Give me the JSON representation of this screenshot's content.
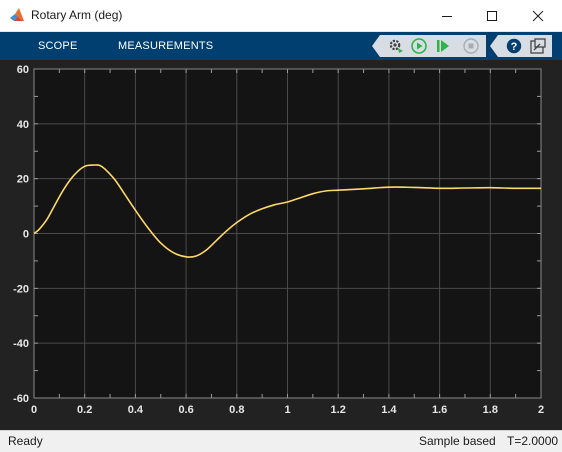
{
  "window": {
    "title": "Rotary Arm (deg)",
    "icon": "matlab-logo-icon",
    "minimize_icon": "minimize-icon",
    "maximize_icon": "maximize-icon",
    "close_icon": "close-icon"
  },
  "toolstrip": {
    "tabs": [
      {
        "label": "SCOPE"
      },
      {
        "label": "MEASUREMENTS"
      }
    ],
    "buttons": [
      {
        "icon": "settings-gear-icon"
      },
      {
        "icon": "run-icon"
      },
      {
        "icon": "step-forward-icon"
      },
      {
        "icon": "stop-icon"
      },
      {
        "icon": "help-icon"
      },
      {
        "icon": "undock-icon"
      }
    ],
    "colors": {
      "background": "#003f6f",
      "run_green": "#2db34a"
    }
  },
  "chart_data": {
    "type": "line",
    "title": "",
    "xlabel": "",
    "ylabel": "",
    "xlim": [
      0,
      2
    ],
    "ylim": [
      -60,
      60
    ],
    "x_ticks": [
      "0",
      "0.2",
      "0.4",
      "0.6",
      "0.8",
      "1",
      "1.2",
      "1.4",
      "1.6",
      "1.8",
      "2"
    ],
    "y_ticks": [
      "60",
      "40",
      "20",
      "0",
      "-20",
      "-40",
      "-60"
    ],
    "grid": true,
    "background": "#141414",
    "series": [
      {
        "color": "#ffd966",
        "x": [
          0,
          0.02,
          0.05,
          0.08,
          0.12,
          0.16,
          0.2,
          0.24,
          0.26,
          0.28,
          0.32,
          0.36,
          0.4,
          0.45,
          0.5,
          0.55,
          0.6,
          0.64,
          0.68,
          0.72,
          0.76,
          0.8,
          0.85,
          0.9,
          0.95,
          1.0,
          1.05,
          1.1,
          1.15,
          1.2,
          1.3,
          1.4,
          1.5,
          1.6,
          1.7,
          1.8,
          1.9,
          2.0
        ],
        "y": [
          0,
          1.5,
          5,
          10,
          16.5,
          21.5,
          24.5,
          25,
          24.8,
          23.5,
          19.5,
          14,
          8.5,
          2,
          -3.5,
          -7,
          -8.5,
          -8.2,
          -6,
          -2.5,
          1,
          4,
          7,
          9,
          10.5,
          11.5,
          13,
          14.5,
          15.5,
          15.8,
          16.3,
          16.9,
          16.8,
          16.5,
          16.6,
          16.7,
          16.5,
          16.5
        ]
      }
    ]
  },
  "status": {
    "left": "Ready",
    "mode": "Sample based",
    "time": "T=2.0000"
  }
}
